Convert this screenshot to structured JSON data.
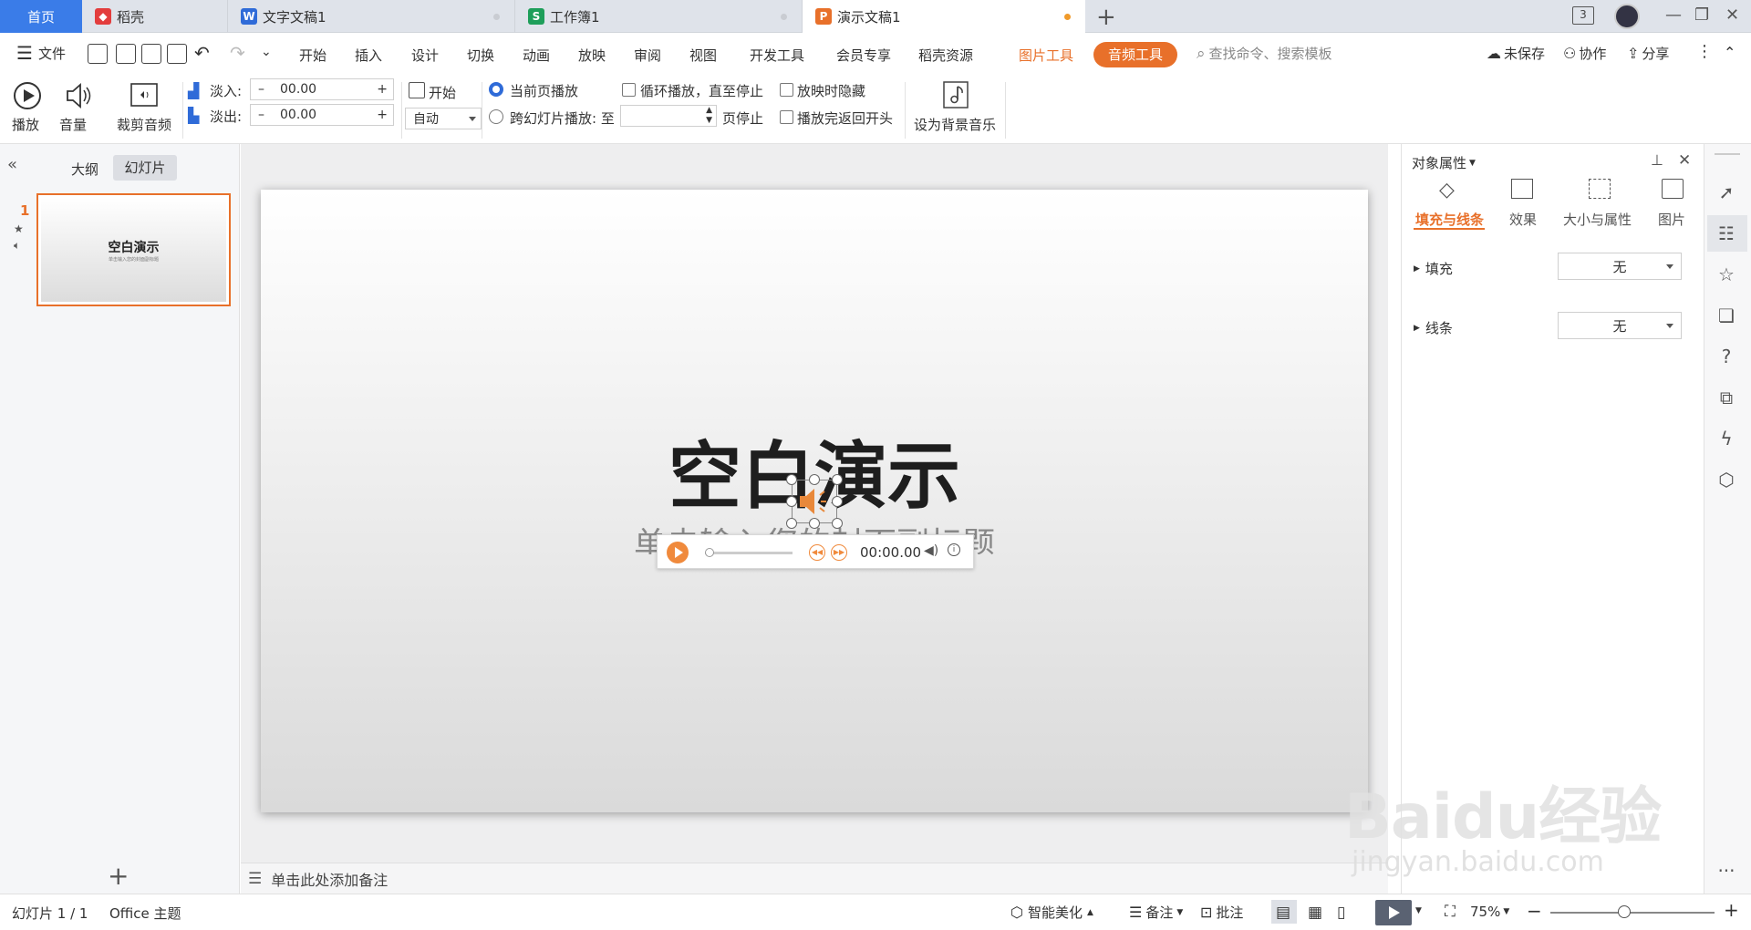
{
  "tabs": {
    "home": "首页",
    "daoke": "稻壳",
    "writer": "文字文稿1",
    "sheet": "工作簿1",
    "present": "演示文稿1",
    "page_count": "3"
  },
  "menu": {
    "file": "文件",
    "items": [
      "开始",
      "插入",
      "设计",
      "切换",
      "动画",
      "放映",
      "审阅",
      "视图",
      "开发工具",
      "会员专享",
      "稻壳资源"
    ],
    "picture_tools": "图片工具",
    "audio_tools": "音频工具",
    "search_placeholder": "查找命令、搜索模板",
    "unsaved": "未保存",
    "collab": "协作",
    "share": "分享"
  },
  "ribbon": {
    "play": "播放",
    "volume": "音量",
    "trim": "裁剪音频",
    "fade_in_label": "淡入:",
    "fade_in_value": "00.00",
    "fade_out_label": "淡出:",
    "fade_out_value": "00.00",
    "start_label": "开始",
    "start_value": "自动",
    "current_page": "当前页播放",
    "cross_slide": "跨幻灯片播放: 至",
    "page_stop": "页停止",
    "loop": "循环播放，直至停止",
    "hide_when_playing": "放映时隐藏",
    "rewind": "播放完返回开头",
    "set_bg_music": "设为背景音乐"
  },
  "leftpane": {
    "outline": "大纲",
    "slides": "幻灯片",
    "slide_number": "1",
    "thumb_title": "空白演示",
    "thumb_subtitle": "单击输入您的封面副标题"
  },
  "slide": {
    "title": "空白演示",
    "subtitle": "单击输入您的封面副标题",
    "audio_time": "00:00.00"
  },
  "notes": {
    "placeholder": "单击此处添加备注"
  },
  "rightpane": {
    "title": "对象属性",
    "tabs": [
      "填充与线条",
      "效果",
      "大小与属性",
      "图片"
    ],
    "fill_label": "填充",
    "fill_value": "无",
    "line_label": "线条",
    "line_value": "无"
  },
  "status": {
    "slide_info": "幻灯片 1 / 1",
    "theme": "Office 主题",
    "beautify": "智能美化",
    "notes": "备注",
    "comments": "批注",
    "zoom": "75%"
  },
  "zoom_fraction": 0.45,
  "watermark": {
    "text": "Baidu经验",
    "url": "jingyan.baidu.com"
  },
  "colors": {
    "accent": "#e8702a",
    "blue": "#3a7ce8"
  }
}
